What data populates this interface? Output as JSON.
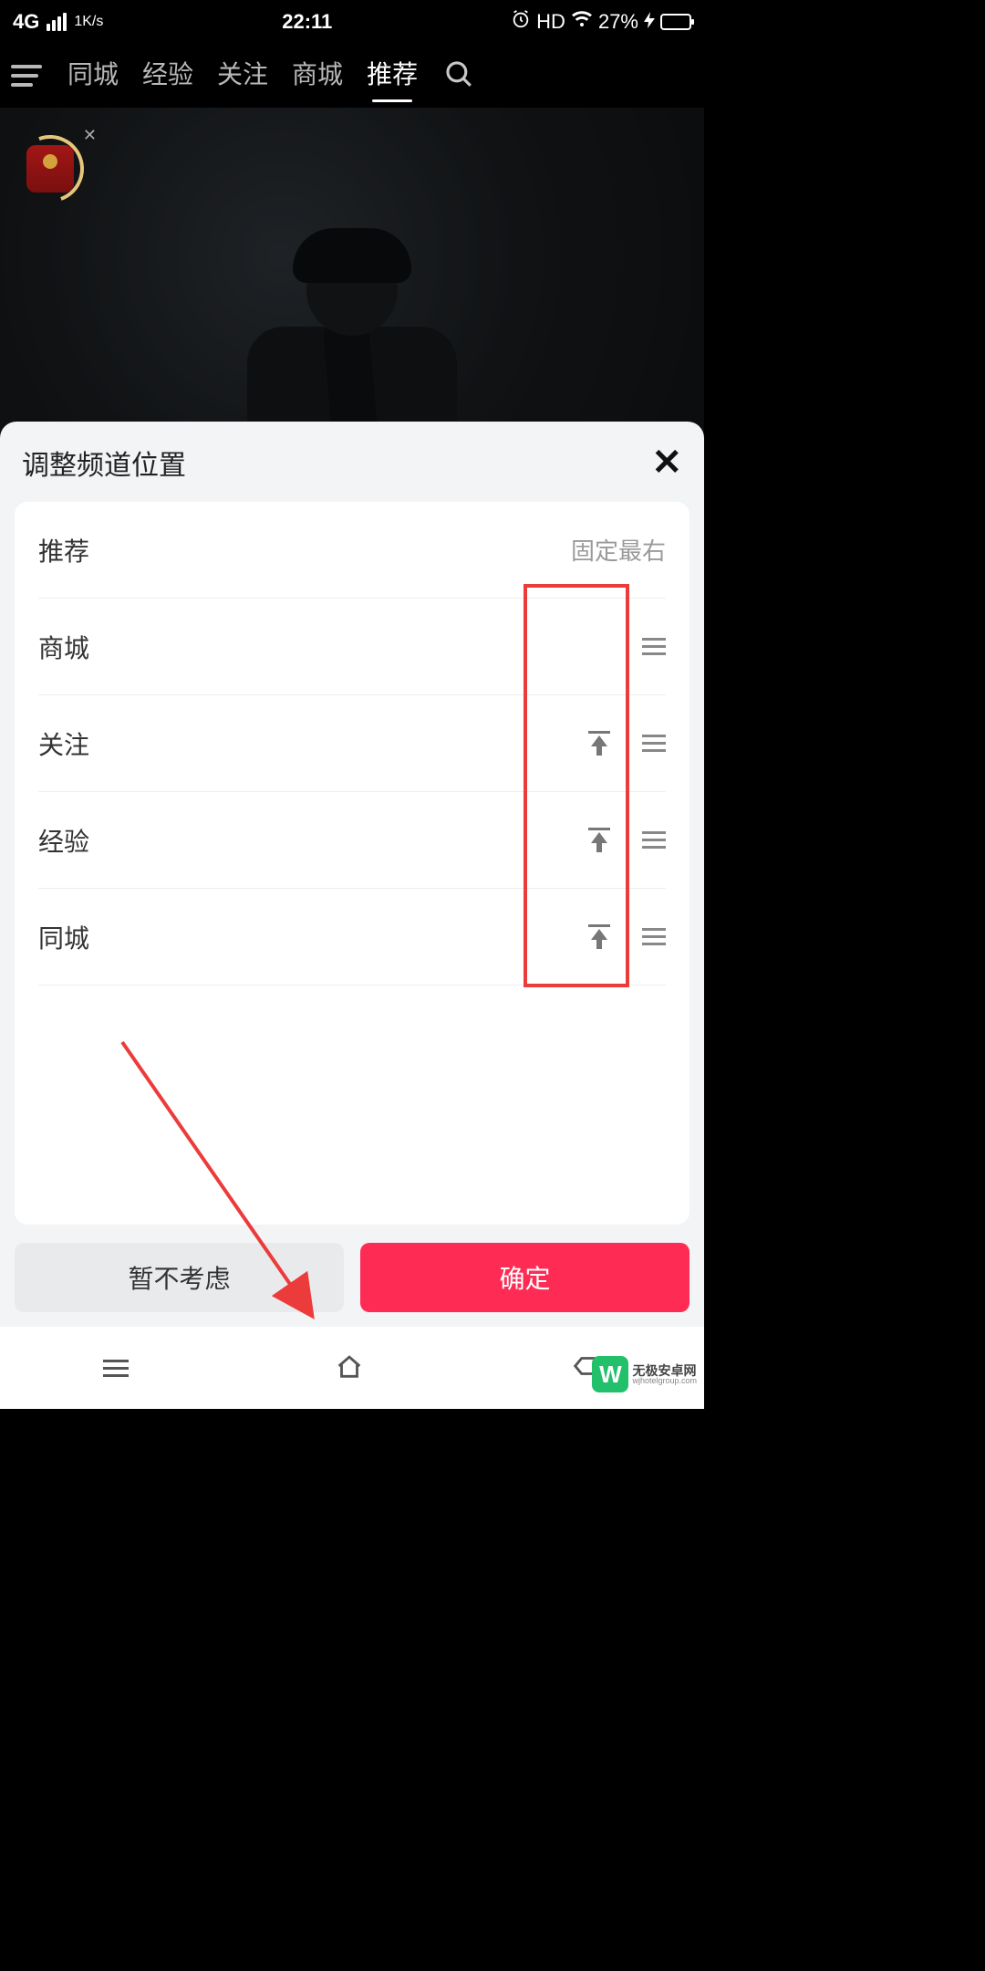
{
  "status": {
    "network": "4G",
    "speed": "1K/s",
    "time": "22:11",
    "hd": "HD",
    "battery_pct": "27%"
  },
  "nav": {
    "tabs": [
      "同城",
      "经验",
      "关注",
      "商城",
      "推荐"
    ],
    "active_index": 4
  },
  "sheet": {
    "title": "调整频道位置",
    "rows": [
      {
        "label": "推荐",
        "right": "固定最右",
        "move_top": false,
        "drag": false
      },
      {
        "label": "商城",
        "right": "",
        "move_top": false,
        "drag": true
      },
      {
        "label": "关注",
        "right": "",
        "move_top": true,
        "drag": true
      },
      {
        "label": "经验",
        "right": "",
        "move_top": true,
        "drag": true
      },
      {
        "label": "同城",
        "right": "",
        "move_top": true,
        "drag": true
      }
    ],
    "cancel": "暂不考虑",
    "confirm": "确定"
  },
  "watermark": {
    "logo_letter": "W",
    "line1": "无极安卓网",
    "line2": "wjhotelgroup.com"
  }
}
